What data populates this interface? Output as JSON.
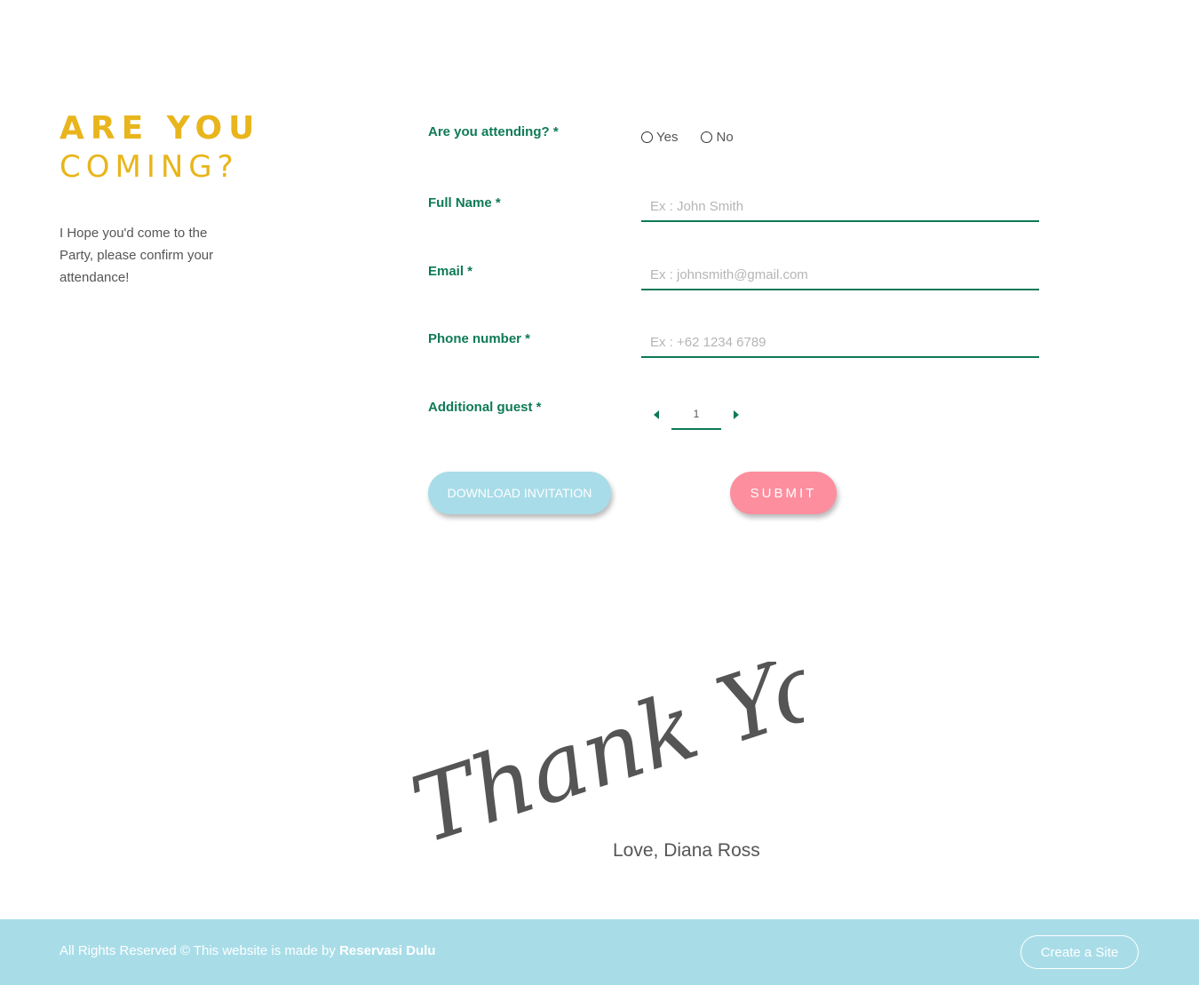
{
  "intro": {
    "title_line1": "ARE YOU",
    "title_line2": "COMING?",
    "description": "I Hope you'd come to the Party, please confirm your attendance!"
  },
  "form": {
    "attending": {
      "label": "Are you attending? *",
      "options": [
        "Yes",
        "No"
      ]
    },
    "full_name": {
      "label": "Full Name *",
      "placeholder": "Ex : John Smith"
    },
    "email": {
      "label": "Email *",
      "placeholder": "Ex : johnsmith@gmail.com"
    },
    "phone": {
      "label": "Phone number *",
      "placeholder": "Ex : +62 1234 6789"
    },
    "guest": {
      "label": "Additional guest *",
      "value": "1"
    },
    "download_label": "DOWNLOAD INVITATION",
    "submit_label": "SUBMIT"
  },
  "thanks": {
    "heading": "Thank You",
    "signature": "Love, Diana Ross"
  },
  "footer": {
    "text": "All Rights Reserved © This website is made by",
    "brand": "Reservasi Dulu",
    "create_label": "Create a Site"
  },
  "colors": {
    "title": "#e8b51c",
    "label": "#0e7a56",
    "download_button": "#a8dce8",
    "submit_button": "#fd8e9e",
    "footer_bg": "#a8dde8"
  },
  "icons": {
    "decrement": "caret-left-icon",
    "increment": "caret-right-icon"
  }
}
